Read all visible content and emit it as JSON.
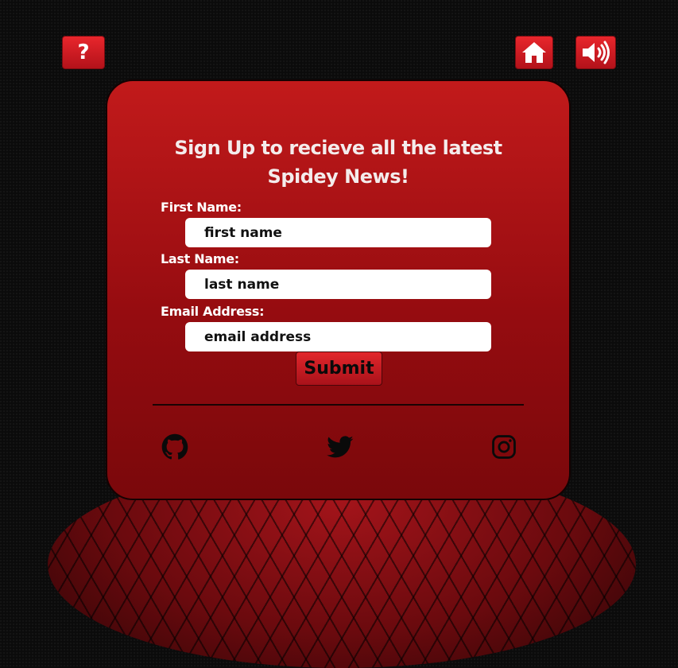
{
  "nav": {
    "help_label": "?",
    "home_icon": "home-icon",
    "sound_icon": "speaker-volume-icon"
  },
  "signup": {
    "heading_line1": "Sign Up to recieve all the latest",
    "heading_line2": "Spidey News!",
    "first_name_label": "First Name:",
    "first_name_placeholder": "first name",
    "last_name_label": "Last Name:",
    "last_name_placeholder": "last name",
    "email_label": "Email Address:",
    "email_placeholder": "email address",
    "submit_label": "Submit"
  },
  "social": {
    "icons": [
      "github-icon",
      "twitter-icon",
      "instagram-icon"
    ]
  },
  "colors": {
    "accent": "#c21a1b",
    "button": "#e2262b",
    "background": "#0b0b0b"
  }
}
